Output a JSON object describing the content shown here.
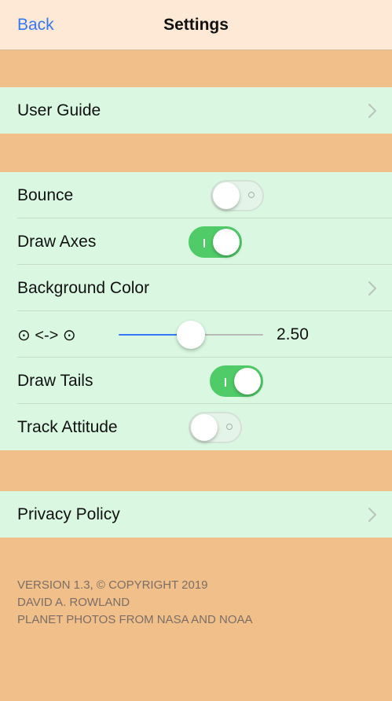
{
  "nav": {
    "back_label": "Back",
    "title": "Settings"
  },
  "sections": {
    "guide": {
      "user_guide_label": "User Guide"
    },
    "options": {
      "bounce_label": "Bounce",
      "bounce_on": false,
      "draw_axes_label": "Draw Axes",
      "draw_axes_on": true,
      "background_color_label": "Background Color",
      "slider_label": "⊙ <-> ⊙",
      "slider_value": "2.50",
      "slider_fraction": 0.5,
      "draw_tails_label": "Draw Tails",
      "draw_tails_on": true,
      "track_attitude_label": "Track Attitude",
      "track_attitude_on": false
    },
    "privacy": {
      "privacy_policy_label": "Privacy Policy"
    }
  },
  "footer": {
    "line1": "VERSION 1.3, © COPYRIGHT 2019",
    "line2": "DAVID A. ROWLAND",
    "line3": "PLANET PHOTOS FROM NASA AND NOAA"
  },
  "colors": {
    "nav_background": "#fde9d5",
    "page_background": "#f1bf8a",
    "cell_background": "#daf8e1",
    "accent": "#3478f6",
    "switch_on": "#4fcb68"
  },
  "icons": {
    "chevron": "chevron-right-icon"
  }
}
